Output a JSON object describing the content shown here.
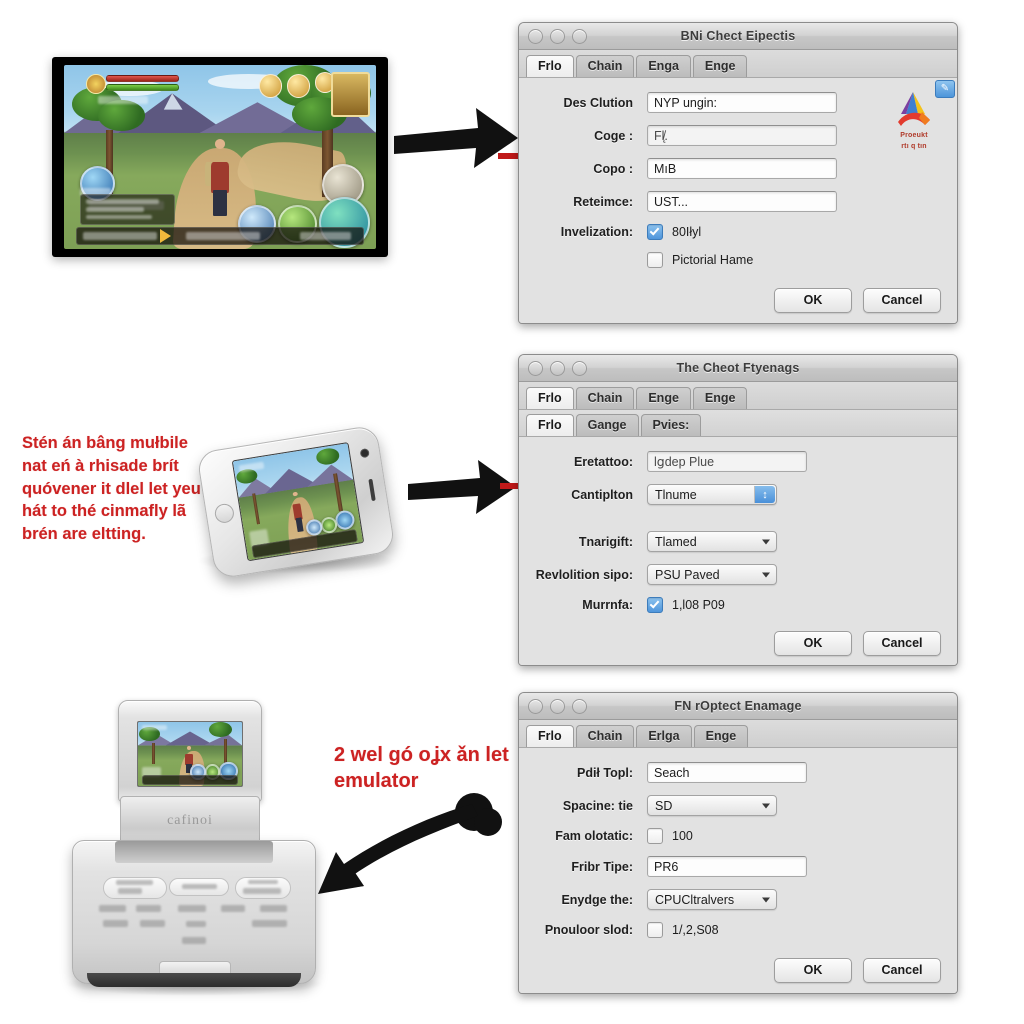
{
  "annotations": {
    "note_middle": "Stén án bâng mułbile nat eń à rhisade brít quóvener it dlel let yeu hát to thé cinmafly lã brén are eltting.",
    "note_bottom": "2 wel gó oʝx ǎn let emulator"
  },
  "dialog1": {
    "title": "BNi Chect Eipectis",
    "tabs": [
      {
        "label": "Frlo",
        "active": true
      },
      {
        "label": "Chain",
        "active": false
      },
      {
        "label": "Enga",
        "active": false
      },
      {
        "label": "Enge",
        "active": false
      }
    ],
    "fields": [
      {
        "label": "Des Clution",
        "value": "NYP ungin:",
        "type": "text-with-button",
        "button_icon": "edit-icon"
      },
      {
        "label": "Coge :",
        "value": "Fl̸̨.",
        "type": "text",
        "dim": true
      },
      {
        "label": "Copo :",
        "value": "MıB",
        "type": "text"
      },
      {
        "label": "Reteimce:",
        "value": "UST...",
        "type": "text"
      },
      {
        "label": "Invelization:",
        "value": "80Iłyl",
        "type": "checkbox",
        "checked": true
      },
      {
        "label": "",
        "value": "Pictorial Hame",
        "type": "checkbox",
        "checked": false
      }
    ],
    "logo_caption_line1": "Proeukt",
    "logo_caption_line2": "rtı q tın",
    "buttons": {
      "ok": "OK",
      "cancel": "Cancel"
    }
  },
  "dialog2": {
    "title": "The Cheot Ftyenags",
    "tabs": [
      {
        "label": "Frlo",
        "active": true
      },
      {
        "label": "Chain",
        "active": false
      },
      {
        "label": "Enge",
        "active": false
      },
      {
        "label": "Enge",
        "active": false
      }
    ],
    "subtabs": [
      {
        "label": "Frlo",
        "active": true
      },
      {
        "label": "Gange",
        "active": false
      },
      {
        "label": "Pvies:",
        "active": false
      }
    ],
    "fields": [
      {
        "label": "Eretattoo:",
        "value": "lցdep Plue",
        "type": "text",
        "dim": true
      },
      {
        "label": "Cantiplton",
        "value": "Tlnume",
        "type": "combo-blue"
      },
      {
        "label": "Tnarigift:",
        "value": "Tlamed",
        "type": "combo"
      },
      {
        "label": "Revlolition sipo:",
        "value": "PSU Paved",
        "type": "combo"
      },
      {
        "label": "Murrnfa:",
        "value": "1,l08 P09",
        "type": "checkbox",
        "checked": true
      }
    ],
    "buttons": {
      "ok": "OK",
      "cancel": "Cancel"
    }
  },
  "dialog3": {
    "title": "FN rOptect Enamage",
    "tabs": [
      {
        "label": "Frlo",
        "active": true
      },
      {
        "label": "Chain",
        "active": false
      },
      {
        "label": "Erlga",
        "active": false
      },
      {
        "label": "Enge",
        "active": false
      }
    ],
    "fields": [
      {
        "label": "Pdił Topl:",
        "value": "Seach",
        "type": "text"
      },
      {
        "label": "Spacine: tie",
        "value": "SD",
        "type": "combo"
      },
      {
        "label": "Fam olotatic:",
        "value": "100",
        "type": "checkbox",
        "checked": false
      },
      {
        "label": "Fribr Tipe:",
        "value": "PR6",
        "type": "text"
      },
      {
        "label": "Enydge the:",
        "value": "CPUCltralvers",
        "type": "combo"
      },
      {
        "label": "Pnouloor slod:",
        "value": "1/,2,S08",
        "type": "checkbox",
        "checked": false
      }
    ],
    "buttons": {
      "ok": "OK",
      "cancel": "Cancel"
    }
  },
  "devices": {
    "game_screenshot_name": "mobile-rpg-gameplay",
    "phone_name": "white-smartphone",
    "console_brand": "cafinoi"
  },
  "colors": {
    "annotation_red": "#cc2222",
    "arrow_black": "#111111",
    "arrow_red": "#c01a1a",
    "dialog_face": "#e2e2e2",
    "accent_blue": "#4a90d9"
  }
}
